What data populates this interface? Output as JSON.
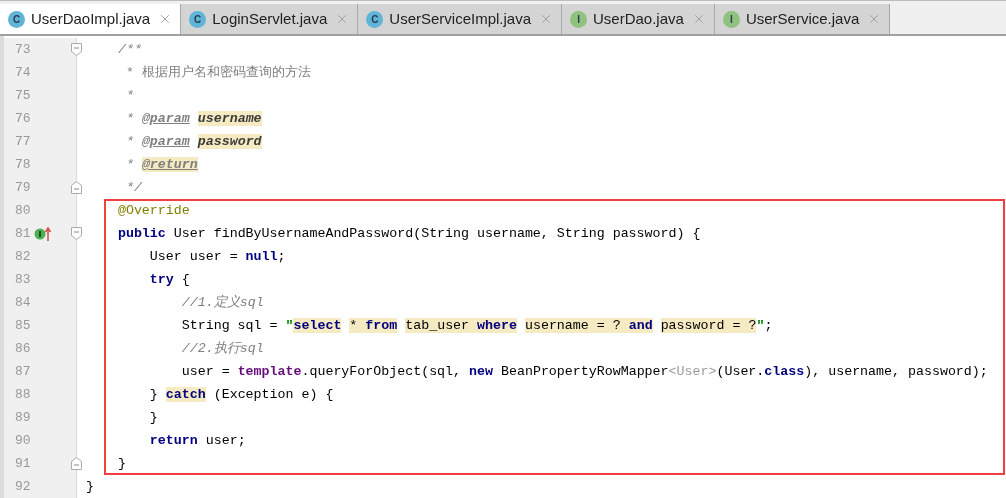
{
  "tabs": [
    {
      "label": "UserDaoImpl.java",
      "kind": "class",
      "badge": "C",
      "selected": true
    },
    {
      "label": "LoginServlet.java",
      "kind": "class",
      "badge": "C",
      "selected": false
    },
    {
      "label": "UserServiceImpl.java",
      "kind": "class",
      "badge": "C",
      "selected": false
    },
    {
      "label": "UserDao.java",
      "kind": "interface",
      "badge": "I",
      "selected": false
    },
    {
      "label": "UserService.java",
      "kind": "interface",
      "badge": "I",
      "selected": false
    }
  ],
  "lines": [
    {
      "number": "73",
      "gutter": [
        {
          "kind": "fold_start"
        }
      ],
      "framed": false,
      "tokens": [
        {
          "text": "    /**",
          "kind": "comment"
        }
      ]
    },
    {
      "number": "74",
      "framed": false,
      "tokens": [
        {
          "text": "     * 根据用户名和密码查询的方法",
          "kind": "doc"
        }
      ]
    },
    {
      "number": "75",
      "framed": false,
      "tokens": [
        {
          "text": "     *",
          "kind": "comment"
        }
      ]
    },
    {
      "number": "76",
      "framed": false,
      "tokens": [
        {
          "text": "     * ",
          "kind": "comment"
        },
        {
          "text": "@param",
          "kind": "doctag",
          "highlighted": false
        },
        {
          "text": " username",
          "kind": "docparam",
          "highlighted": true
        }
      ]
    },
    {
      "number": "77",
      "framed": false,
      "tokens": [
        {
          "text": "     * ",
          "kind": "comment"
        },
        {
          "text": "@param",
          "kind": "doctag",
          "highlighted": false
        },
        {
          "text": " password",
          "kind": "docparam",
          "highlighted": true
        }
      ]
    },
    {
      "number": "78",
      "framed": false,
      "tokens": [
        {
          "text": "     * ",
          "kind": "comment"
        },
        {
          "text": "@return",
          "kind": "doctag",
          "highlighted": true
        }
      ]
    },
    {
      "number": "79",
      "gutter": [
        {
          "kind": "fold_end"
        }
      ],
      "framed": false,
      "tokens": [
        {
          "text": "     */",
          "kind": "comment"
        }
      ]
    },
    {
      "number": "80",
      "framed": true,
      "tokens": [
        {
          "text": "    @Override",
          "kind": "annotation"
        }
      ]
    },
    {
      "number": "81",
      "gutter": [
        {
          "kind": "implements"
        },
        {
          "kind": "fold_start"
        }
      ],
      "framed": true,
      "tokens": [
        {
          "text": "    public",
          "kind": "keyword"
        },
        {
          "text": " User findByUsernameAndPassword(String username, String password) {",
          "kind": "plain"
        }
      ]
    },
    {
      "number": "82",
      "framed": true,
      "tokens": [
        {
          "text": "        User user = ",
          "kind": "plain"
        },
        {
          "text": "null",
          "kind": "keyword"
        },
        {
          "text": ";",
          "kind": "plain"
        }
      ]
    },
    {
      "number": "83",
      "framed": true,
      "tokens": [
        {
          "text": "        try",
          "kind": "keyword"
        },
        {
          "text": " {",
          "kind": "plain"
        }
      ]
    },
    {
      "number": "84",
      "framed": true,
      "tokens": [
        {
          "text": "            //1.定义sql",
          "kind": "comment"
        }
      ]
    },
    {
      "number": "85",
      "framed": true,
      "tokens": [
        {
          "text": "            String sql = ",
          "kind": "plain"
        },
        {
          "text": "\"",
          "kind": "string"
        },
        {
          "text": "select",
          "kind": "keyword",
          "highlighted": true
        },
        {
          "text": " * ",
          "kind": "plain",
          "highlighted": true
        },
        {
          "text": "from",
          "kind": "keyword",
          "highlighted": true
        },
        {
          "text": " tab_user ",
          "kind": "plain",
          "highlighted": true
        },
        {
          "text": "where",
          "kind": "keyword",
          "highlighted": true
        },
        {
          "text": " username = ? ",
          "kind": "plain",
          "highlighted": true
        },
        {
          "text": "and",
          "kind": "keyword",
          "highlighted": true
        },
        {
          "text": " password = ?",
          "kind": "plain",
          "highlighted": true
        },
        {
          "text": "\"",
          "kind": "string"
        },
        {
          "text": ";",
          "kind": "plain"
        }
      ]
    },
    {
      "number": "86",
      "framed": true,
      "tokens": [
        {
          "text": "            //2.执行sql",
          "kind": "comment"
        }
      ]
    },
    {
      "number": "87",
      "framed": true,
      "tokens": [
        {
          "text": "            user = ",
          "kind": "plain"
        },
        {
          "text": "template",
          "kind": "field"
        },
        {
          "text": ".queryForObject(sql, ",
          "kind": "plain"
        },
        {
          "text": "new",
          "kind": "keyword"
        },
        {
          "text": " BeanPropertyRowMapper",
          "kind": "plain"
        },
        {
          "text": "<User>",
          "kind": "generic"
        },
        {
          "text": "(User.",
          "kind": "plain"
        },
        {
          "text": "class",
          "kind": "keyword"
        },
        {
          "text": "), username, password);",
          "kind": "plain"
        }
      ]
    },
    {
      "number": "88",
      "framed": true,
      "tokens": [
        {
          "text": "        } ",
          "kind": "plain"
        },
        {
          "text": "catch",
          "kind": "keyword",
          "highlighted": true
        },
        {
          "text": " (Exception e) {",
          "kind": "plain"
        }
      ]
    },
    {
      "number": "89",
      "framed": true,
      "tokens": [
        {
          "text": "        }",
          "kind": "plain"
        }
      ]
    },
    {
      "number": "90",
      "framed": true,
      "tokens": [
        {
          "text": "        return",
          "kind": "keyword"
        },
        {
          "text": " user;",
          "kind": "plain"
        }
      ]
    },
    {
      "number": "91",
      "gutter": [
        {
          "kind": "fold_end"
        }
      ],
      "framed": true,
      "tokens": [
        {
          "text": "    }",
          "kind": "plain"
        }
      ]
    },
    {
      "number": "92",
      "framed": false,
      "tokens": [
        {
          "text": "}",
          "kind": "plain"
        }
      ]
    }
  ]
}
